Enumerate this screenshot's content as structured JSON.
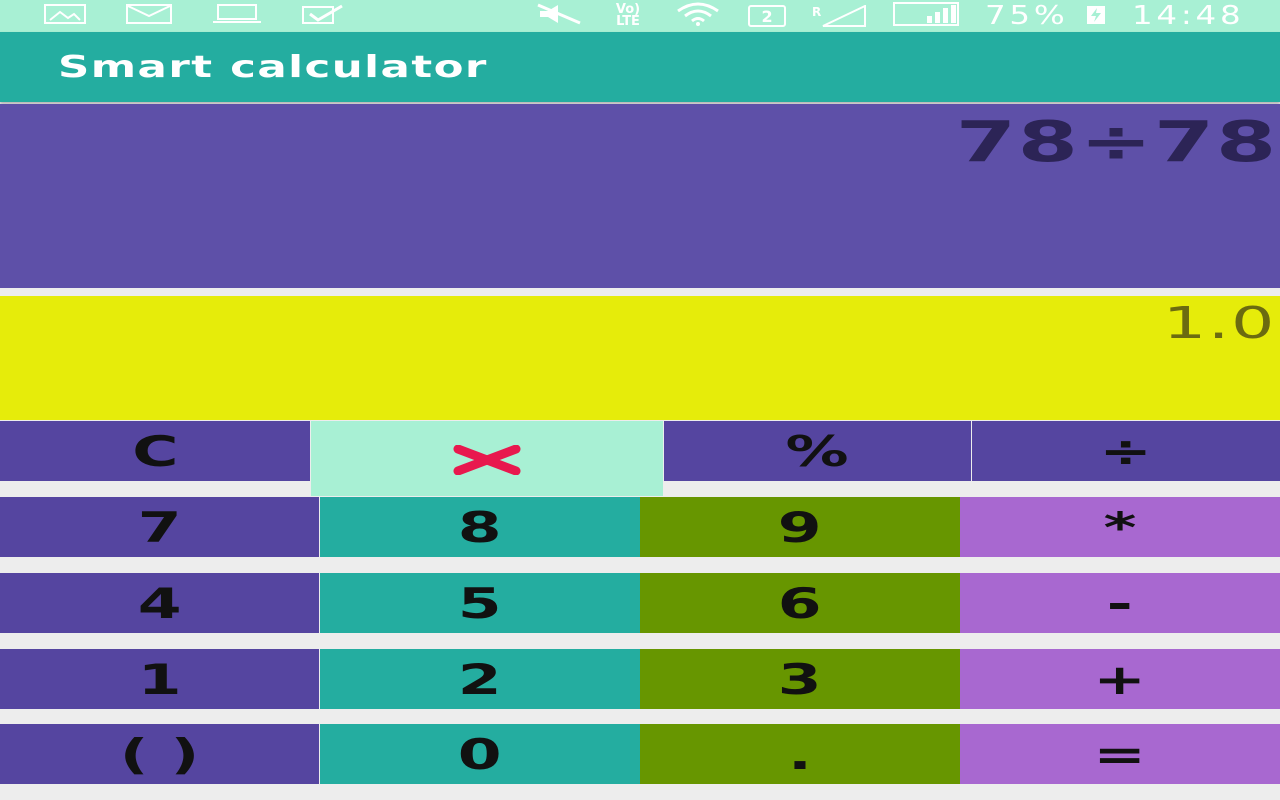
{
  "status_bar": {
    "lte_label": "Vo) LTE",
    "sim_label": "2",
    "roaming_label": "R",
    "battery_percent": "75%",
    "time": "14:48",
    "icons": [
      "gallery-icon",
      "mail-icon",
      "laptop-icon",
      "check-icon",
      "mute-icon",
      "lte-icon",
      "wifi-icon",
      "sim2-icon",
      "signal-icon",
      "signal-icon",
      "battery-charging-icon"
    ]
  },
  "app_bar": {
    "title": "Smart calculator"
  },
  "display": {
    "expression": "78÷78",
    "result": "1.0"
  },
  "colors": {
    "app_bar": "#24ada0",
    "status_bar": "#a8f0d4",
    "expression_bg": "#5e50a8",
    "result_bg": "#e6ec0a",
    "key_purple": "#5545a0",
    "key_teal": "#24ada0",
    "key_green": "#679600",
    "key_lilac": "#a868d0",
    "delete_icon": "#e8184e"
  },
  "keys": {
    "clear": "C",
    "percent": "%",
    "divide": "÷",
    "seven": "7",
    "eight": "8",
    "nine": "9",
    "multiply": "*",
    "four": "4",
    "five": "5",
    "six": "6",
    "minus": "-",
    "one": "1",
    "two": "2",
    "three": "3",
    "plus": "+",
    "parentheses": "( )",
    "zero": "0",
    "dot": ".",
    "equals": "="
  }
}
